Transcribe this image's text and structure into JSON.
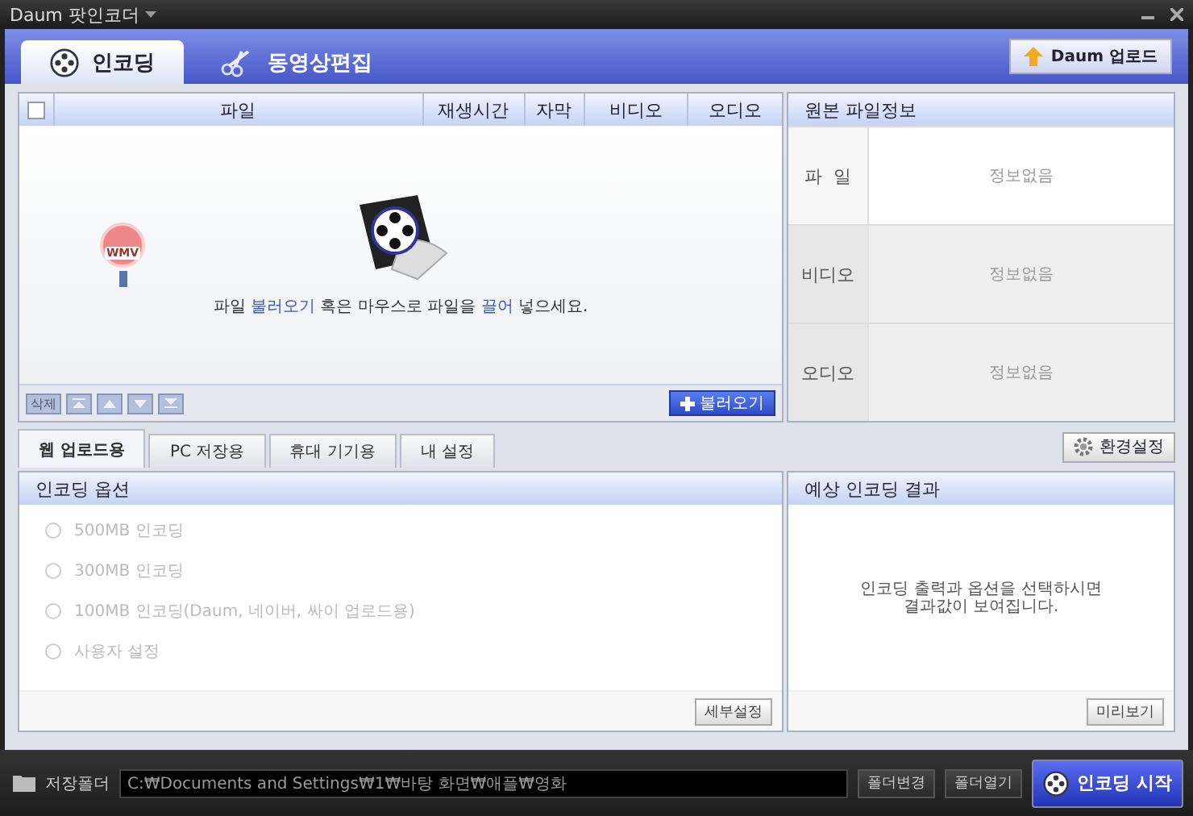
{
  "window": {
    "title": "Daum 팟인코더"
  },
  "main_tabs": [
    {
      "label": "인코딩",
      "selected": true,
      "kind": "encode"
    },
    {
      "label": "동영상편집",
      "selected": false,
      "kind": "edit"
    }
  ],
  "upload_button": "Daum 업로드",
  "file_list": {
    "select_all_checked": false,
    "columns": [
      "파일",
      "재생시간",
      "자막",
      "비디오",
      "오디오"
    ],
    "dragged_file": {
      "format": "WMV"
    },
    "drop_hint": [
      {
        "text": "파일 ",
        "link": false
      },
      {
        "text": "불러오기",
        "link": true
      },
      {
        "text": " 혹은 마우스로 파일을 ",
        "link": false
      },
      {
        "text": "끌어",
        "link": true
      },
      {
        "text": " 넣으세요.",
        "link": false
      }
    ],
    "delete_button": "삭제",
    "import_button": "불러오기"
  },
  "source_info": {
    "title": "원본 파일정보",
    "rows": [
      {
        "label": "파  일",
        "value": "정보없음"
      },
      {
        "label": "비디오",
        "value": "정보없음"
      },
      {
        "label": "오디오",
        "value": "정보없음"
      }
    ]
  },
  "preset_tabs": [
    {
      "label": "웹 업로드용",
      "selected": true
    },
    {
      "label": "PC 저장용",
      "selected": false
    },
    {
      "label": "휴대 기기용",
      "selected": false
    },
    {
      "label": "내 설정",
      "selected": false
    }
  ],
  "settings_button": "환경설정",
  "encoding_options": {
    "title": "인코딩 옵션",
    "options": [
      {
        "label": "500MB 인코딩",
        "selected": false,
        "disabled": true
      },
      {
        "label": "300MB 인코딩",
        "selected": false,
        "disabled": true
      },
      {
        "label": "100MB 인코딩(Daum, 네이버, 싸이 업로드용)",
        "selected": false,
        "disabled": true
      },
      {
        "label": "사용자 설정",
        "selected": false,
        "disabled": true
      }
    ],
    "detail_button": "세부설정"
  },
  "expected_result": {
    "title": "예상 인코딩 결과",
    "message": "인코딩 출력과 옵션을 선택하시면\n결과값이 보여집니다.",
    "preview_button": "미리보기"
  },
  "bottom_bar": {
    "folder_label": "저장폴더",
    "path": "C:₩Documents and Settings₩1₩바탕 화면₩애플₩영화",
    "change_button": "폴더변경",
    "open_button": "폴더열기",
    "start_button": "인코딩 시작"
  }
}
